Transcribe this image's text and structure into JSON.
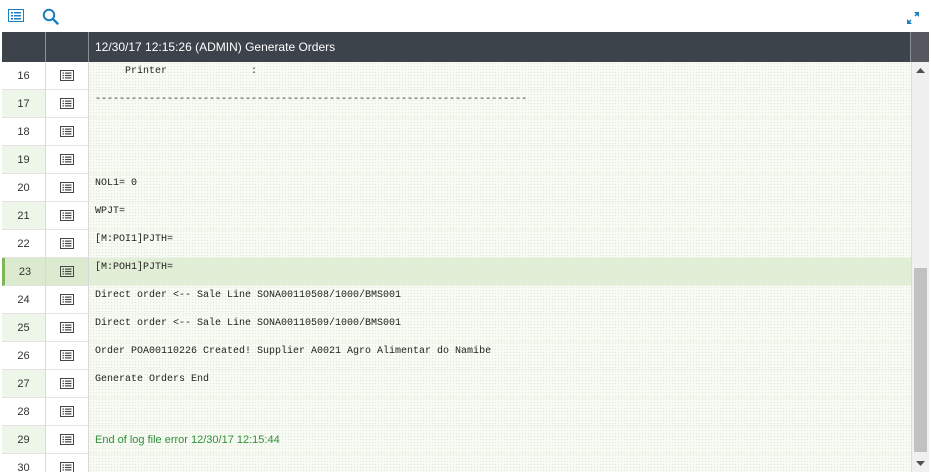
{
  "toolbar": {
    "left_icons": [
      "list-icon",
      "search-icon"
    ],
    "right_icon": "expand-icon"
  },
  "header": {
    "title": "12/30/17 12:15:26 (ADMIN) Generate Orders"
  },
  "rows": [
    {
      "num": "16",
      "text": "     Printer              :",
      "style": "mono"
    },
    {
      "num": "17",
      "text": "------------------------------------------------------------------------",
      "style": "mono"
    },
    {
      "num": "18",
      "text": "",
      "style": "mono"
    },
    {
      "num": "19",
      "text": "",
      "style": "mono"
    },
    {
      "num": "20",
      "text": "NOL1= 0",
      "style": "mono"
    },
    {
      "num": "21",
      "text": "WPJT=",
      "style": "mono"
    },
    {
      "num": "22",
      "text": "[M:POI1]PJTH=",
      "style": "mono"
    },
    {
      "num": "23",
      "text": "[M:POH1]PJTH=",
      "style": "mono",
      "selected": true
    },
    {
      "num": "24",
      "text": "Direct order <-- Sale Line SONA00110508/1000/BMS001",
      "style": "mono"
    },
    {
      "num": "25",
      "text": "Direct order <-- Sale Line SONA00110509/1000/BMS001",
      "style": "mono"
    },
    {
      "num": "26",
      "text": "Order POA00110226 Created! Supplier A0021 Agro Alimentar do Namibe",
      "style": "mono"
    },
    {
      "num": "27",
      "text": "Generate Orders End",
      "style": "mono"
    },
    {
      "num": "28",
      "text": "",
      "style": "mono"
    },
    {
      "num": "29",
      "text": "End of log file error 12/30/17 12:15:44",
      "style": "green"
    },
    {
      "num": "30",
      "text": "",
      "style": "mono"
    }
  ],
  "colors": {
    "header_bg": "#3d434a",
    "accent": "#1a7fc1",
    "selected_row": "#dcebcf",
    "green_text": "#2f8f3a"
  }
}
